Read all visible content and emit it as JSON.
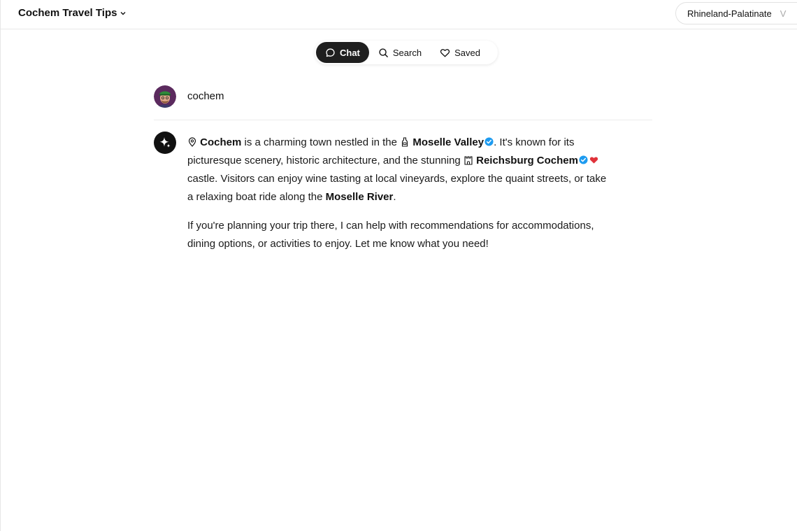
{
  "header": {
    "title": "Cochem Travel Tips",
    "region": "Rhineland-Palatinate",
    "region_overflow": "V"
  },
  "tabs": [
    {
      "label": "Chat",
      "icon": "chat-bubble-icon",
      "active": true
    },
    {
      "label": "Search",
      "icon": "search-icon",
      "active": false
    },
    {
      "label": "Saved",
      "icon": "heart-outline-icon",
      "active": false
    }
  ],
  "query": {
    "text": "cochem"
  },
  "answer": {
    "p1": {
      "entity1": "Cochem",
      "t1": " is a charming town nestled in the ",
      "entity2": "Moselle Valley",
      "t2": ". It's known for its picturesque scenery, historic architecture, and the stunning ",
      "entity3": "Reichsburg Cochem",
      "t3": " castle. Visitors can enjoy wine tasting at local vineyards, explore the quaint streets, or take a relaxing boat ride along the ",
      "entity4": "Moselle River",
      "t4": "."
    },
    "p2": "If you're planning your trip there, I can help with recommendations for accommodations, dining options, or activities to enjoy. Let me know what you need!"
  },
  "colors": {
    "verified": "#1d9bf0",
    "heart": "#e0323a",
    "active_tab": "#1f1f1f"
  }
}
